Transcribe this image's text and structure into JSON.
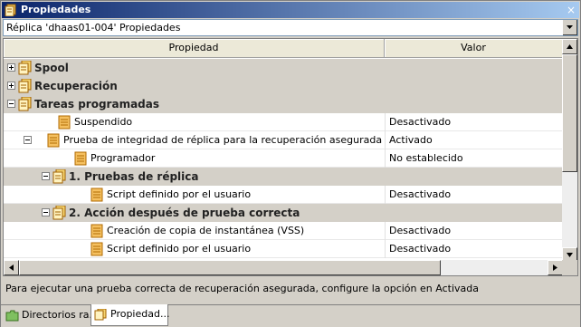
{
  "window": {
    "title": "Propiedades",
    "close_label": "×"
  },
  "combo": {
    "value": "Réplica  'dhaas01-004' Propiedades"
  },
  "grid": {
    "headers": {
      "property": "Propiedad",
      "value": "Valor"
    },
    "rows": [
      {
        "label": "Spool",
        "value": "",
        "category": true,
        "expander": "plus"
      },
      {
        "label": "Recuperación",
        "value": "",
        "category": true,
        "expander": "plus"
      },
      {
        "label": "Tareas programadas",
        "value": "",
        "category": true,
        "expander": "minus"
      },
      {
        "label": "Suspendido",
        "value": "Desactivado",
        "category": false,
        "expander": ""
      },
      {
        "label": "Prueba de integridad de réplica para la recuperación asegurada",
        "value": "Activado",
        "category": false,
        "expander": "minus"
      },
      {
        "label": "Programador",
        "value": "No establecido",
        "category": false,
        "expander": ""
      },
      {
        "label": "1. Pruebas de réplica",
        "value": "",
        "category": true,
        "expander": "minus"
      },
      {
        "label": "Script definido por el usuario",
        "value": "Desactivado",
        "category": false,
        "expander": ""
      },
      {
        "label": "2. Acción después de prueba correcta",
        "value": "",
        "category": true,
        "expander": "minus"
      },
      {
        "label": "Creación de copia de instantánea (VSS)",
        "value": "Desactivado",
        "category": false,
        "expander": ""
      },
      {
        "label": "Script definido por el usuario",
        "value": "Desactivado",
        "category": false,
        "expander": ""
      }
    ]
  },
  "status_text": "Para ejecutar una prueba correcta de recuperación asegurada, configure la opción en Activada",
  "tabs": [
    {
      "label": "Directorios  ra...",
      "icon": "folder-icon",
      "active": false
    },
    {
      "label": "Propiedad...",
      "icon": "properties-icon",
      "active": true
    }
  ],
  "colors": {
    "titlebar": "#0a246a",
    "category_bg": "#d4d0c8",
    "icon_orange": "#e8a000"
  }
}
